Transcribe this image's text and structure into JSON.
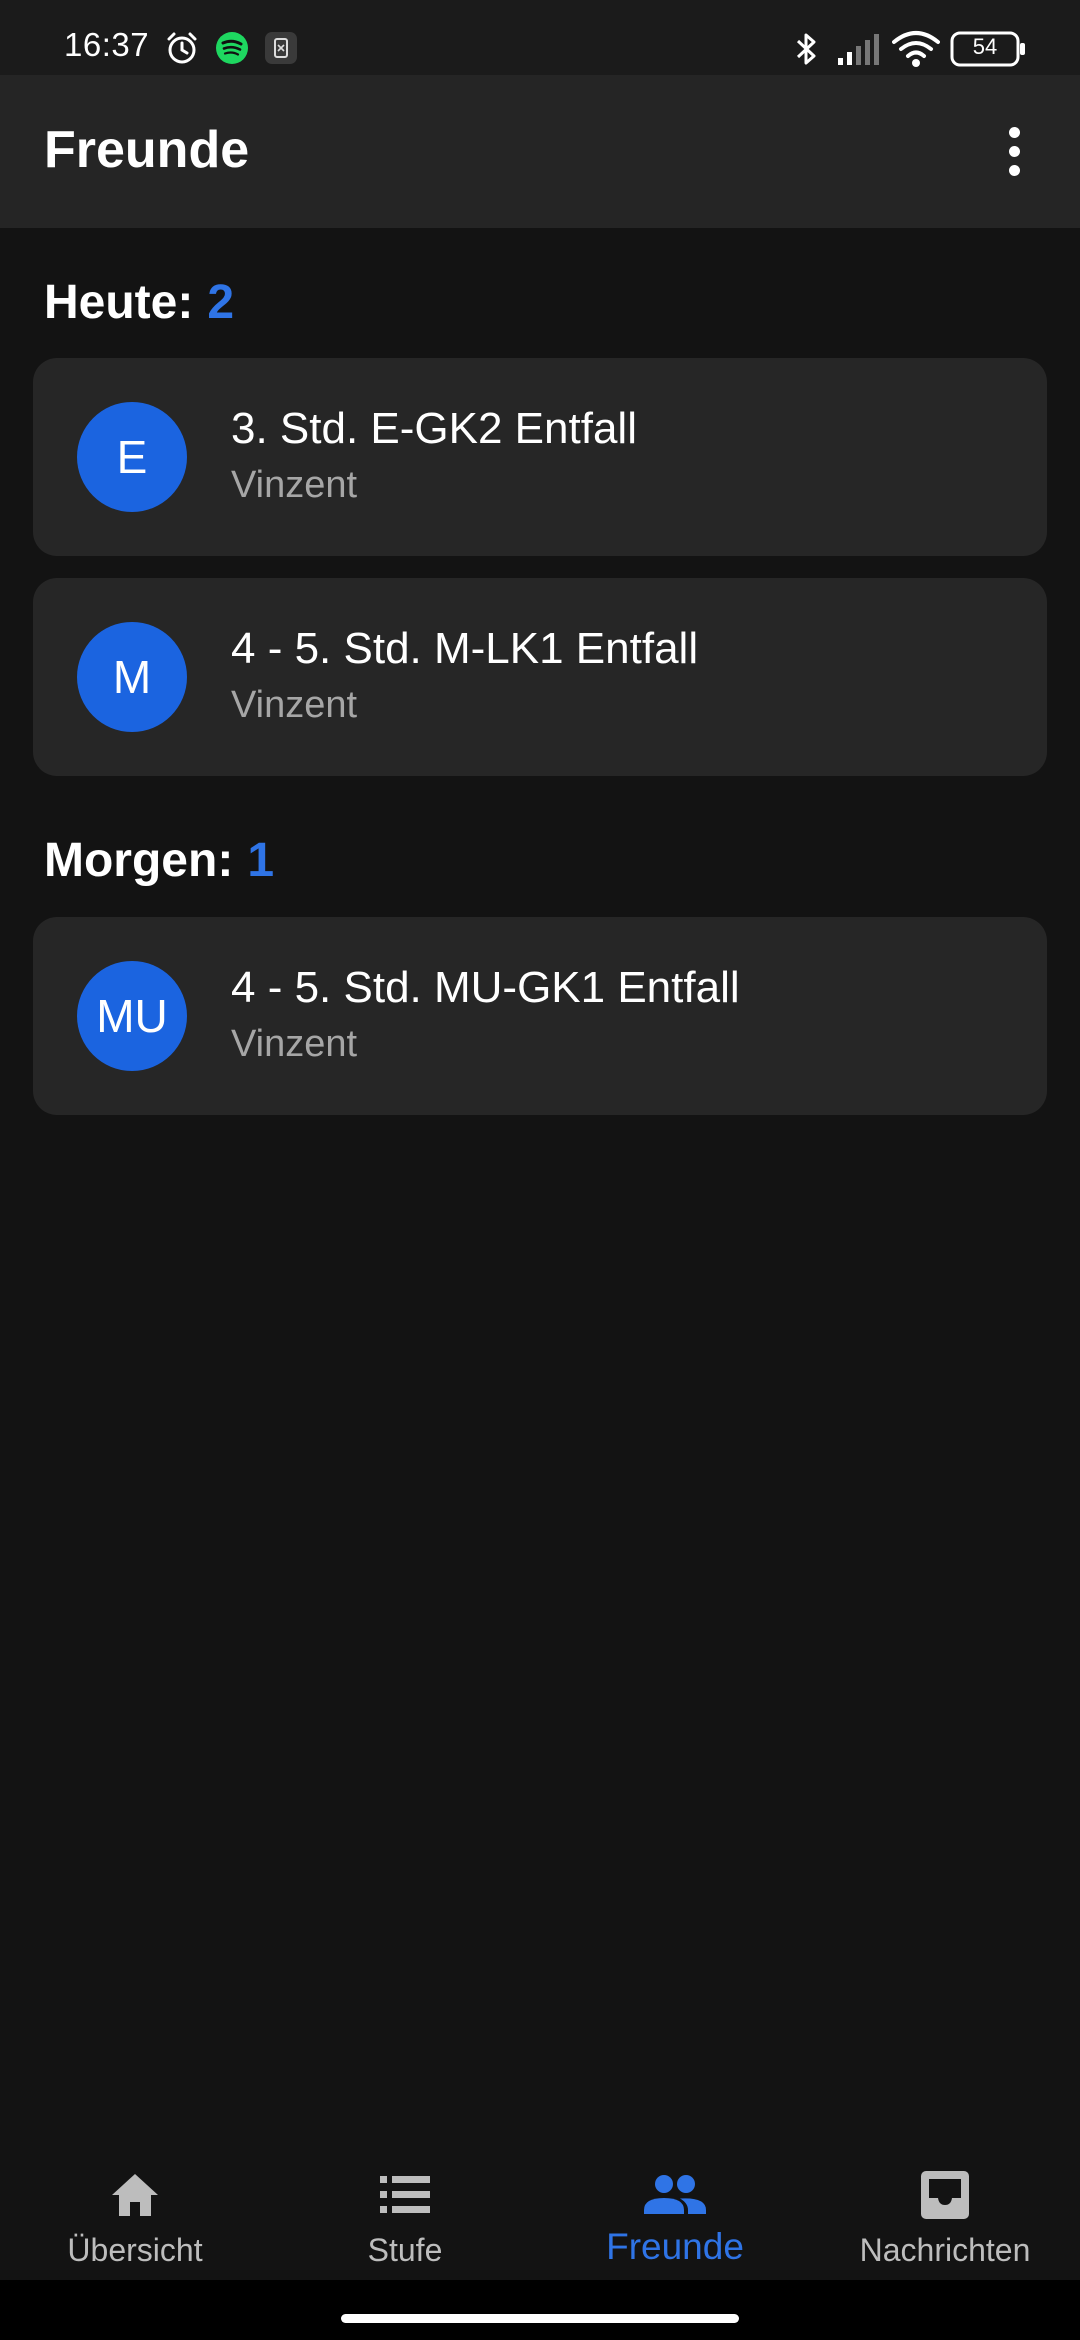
{
  "status_bar": {
    "time": "16:37",
    "battery": "54",
    "left_icons": [
      "alarm-icon",
      "spotify-icon",
      "app-notification-icon"
    ],
    "right_icons": [
      "bluetooth-icon",
      "cellular-signal-icon",
      "wifi-icon",
      "battery-icon"
    ]
  },
  "app_bar": {
    "title": "Freunde",
    "menu_icon": "more-vert-icon"
  },
  "sections": [
    {
      "label": "Heute:",
      "count": "2",
      "items": [
        {
          "avatar": "E",
          "title": "3. Std. E-GK2 Entfall",
          "subtitle": "Vinzent"
        },
        {
          "avatar": "M",
          "title": "4 - 5. Std. M-LK1 Entfall",
          "subtitle": "Vinzent"
        }
      ]
    },
    {
      "label": "Morgen:",
      "count": "1",
      "items": [
        {
          "avatar": "MU",
          "title": "4 - 5. Std. MU-GK1 Entfall",
          "subtitle": "Vinzent"
        }
      ]
    }
  ],
  "bottom_nav": {
    "active": "Freunde",
    "items": [
      {
        "label": "Übersicht",
        "icon": "home-icon"
      },
      {
        "label": "Stufe",
        "icon": "list-icon"
      },
      {
        "label": "Freunde",
        "icon": "people-icon"
      },
      {
        "label": "Nachrichten",
        "icon": "inbox-icon"
      }
    ]
  },
  "colors": {
    "background": "#131313",
    "card": "#262626",
    "app_bar": "#252525",
    "accent": "#2f74e6",
    "avatar": "#1b64e0",
    "secondary_text": "#a6a6a6"
  }
}
